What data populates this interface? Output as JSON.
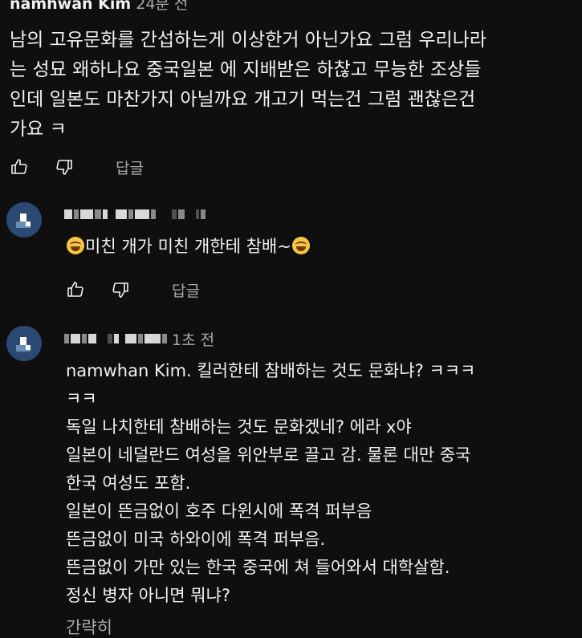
{
  "top_comment": {
    "author": "namhwan Kim",
    "time": "24분 전",
    "lines": [
      "남의 고유문화를 간섭하는게 이상한거 아닌가요  그럼 우리나라",
      "는 성묘 왜하나요  중국일본 에 지배받은 하찮고 무능한 조상들",
      "인데  일본도 마찬가지 아닐까요  개고기 먹는건 그럼  괜찮은건",
      "가요 ㅋ"
    ],
    "reply_label": "답글"
  },
  "reply1": {
    "lines": [
      "미친 개가 미친 개한테 참배~"
    ],
    "reply_label": "답글"
  },
  "reply2": {
    "time": "1초 전",
    "lines": [
      "namwhan Kim. 킬러한테 참배하는 것도 문화냐? ㅋㅋㅋ",
      "ㅋㅋ",
      "독일 나치한테 참배하는 것도 문화겠네? 에라 x야",
      "일본이 네덜란드 여성을 위안부로 끌고 감. 물론 대만 중국",
      "한국 여성도 포함.",
      "일본이 뜬금없이 호주 다윈시에 폭격 퍼부음",
      "뜬금없이 미국 하와이에 폭격 퍼부음.",
      "뜬금없이 가만 있는 한국 중국에 쳐 들어와서 대학살함.",
      "정신 병자 아니면 뭐냐?"
    ],
    "collapse_label": "간략히"
  },
  "icons": {
    "like": "thumb-up-icon",
    "dislike": "thumb-down-icon",
    "emoji": "rolling-on-floor-laughing-emoji"
  },
  "colors": {
    "background": "#0f0f0f",
    "text": "#f1f1f1",
    "secondary_text": "#aaaaaa",
    "avatar": "#2b4a73"
  }
}
